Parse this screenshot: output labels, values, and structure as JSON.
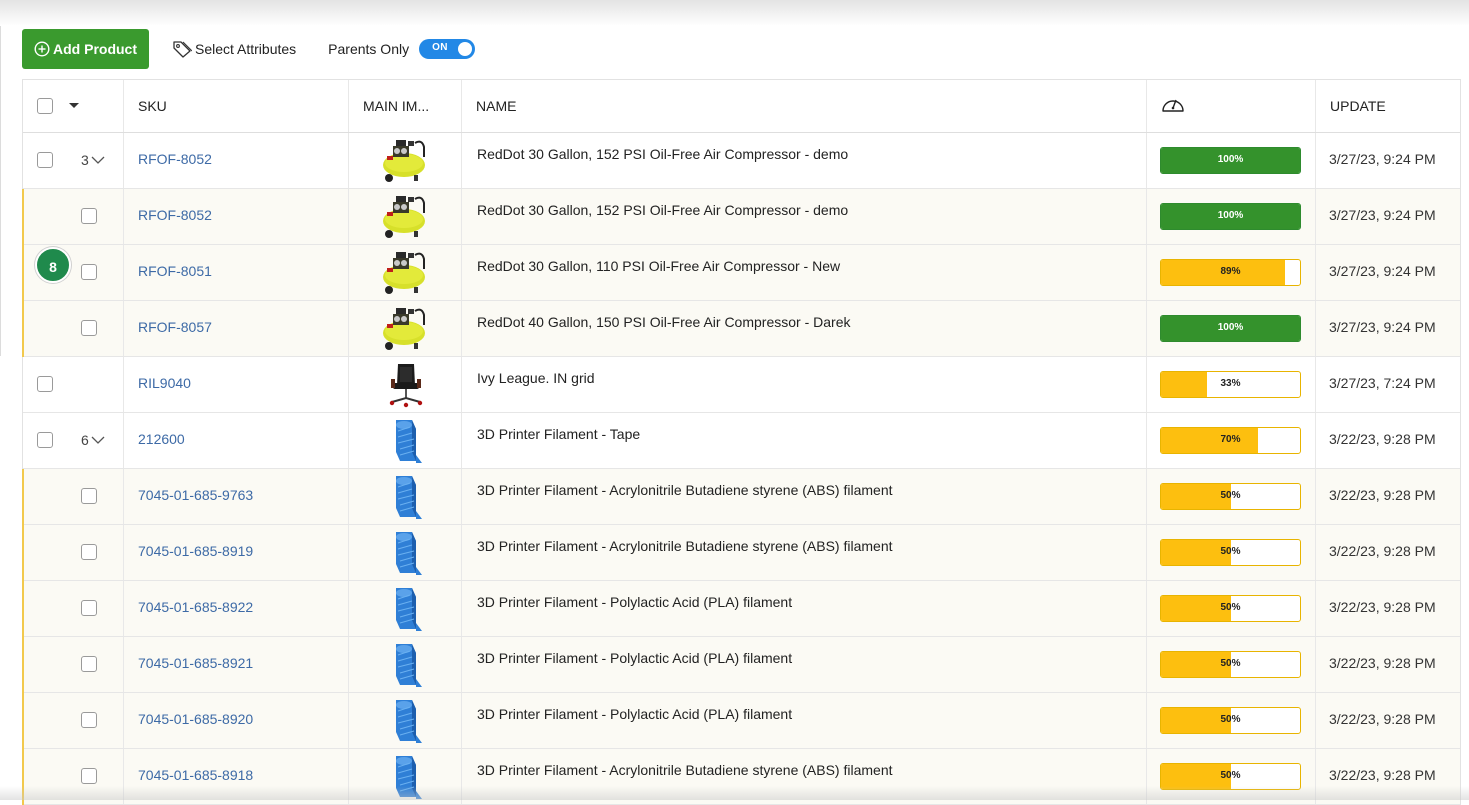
{
  "toolbar": {
    "add_product_label": "Add Product",
    "select_attributes_label": "Select Attributes",
    "parents_only_label": "Parents Only",
    "parents_only_toggle": "ON"
  },
  "table": {
    "headers": {
      "sku": "SKU",
      "main_image": "MAIN IM...",
      "name": "NAME",
      "completeness_icon": "gauge-icon",
      "update": "UPDATE"
    },
    "rows": [
      {
        "type": "parent",
        "expand_count": "3",
        "sku": "RFOF-8052",
        "image": "air-compressor",
        "name": "RedDot 30 Gallon, 152 PSI Oil-Free Air Compressor - demo",
        "completeness": 100,
        "completeness_label": "100%",
        "updated": "3/27/23, 9:24 PM"
      },
      {
        "type": "child",
        "sku": "RFOF-8052",
        "image": "air-compressor",
        "name": "RedDot 30 Gallon, 152 PSI Oil-Free Air Compressor - demo",
        "completeness": 100,
        "completeness_label": "100%",
        "updated": "3/27/23, 9:24 PM"
      },
      {
        "type": "child",
        "sku": "RFOF-8051",
        "image": "air-compressor",
        "name": "RedDot 30 Gallon, 110 PSI Oil-Free Air Compressor - New",
        "completeness": 89,
        "completeness_label": "89%",
        "updated": "3/27/23, 9:24 PM"
      },
      {
        "type": "child",
        "sku": "RFOF-8057",
        "image": "air-compressor",
        "name": "RedDot 40 Gallon, 150 PSI Oil-Free Air Compressor - Darek",
        "completeness": 100,
        "completeness_label": "100%",
        "updated": "3/27/23, 9:24 PM"
      },
      {
        "type": "single",
        "sku": "RIL9040",
        "image": "office-chair",
        "name": "Ivy League. IN grid",
        "completeness": 33,
        "completeness_label": "33%",
        "updated": "3/27/23, 7:24 PM"
      },
      {
        "type": "parent",
        "expand_count": "6",
        "sku": "212600",
        "image": "filament-tape",
        "name": "3D Printer Filament - Tape",
        "completeness": 70,
        "completeness_label": "70%",
        "updated": "3/22/23, 9:28 PM"
      },
      {
        "type": "child",
        "sku": "7045-01-685-9763",
        "image": "filament-tape",
        "name": "3D Printer Filament - Acrylonitrile Butadiene styrene (ABS) filament",
        "completeness": 50,
        "completeness_label": "50%",
        "updated": "3/22/23, 9:28 PM"
      },
      {
        "type": "child",
        "sku": "7045-01-685-8919",
        "image": "filament-tape",
        "name": "3D Printer Filament - Acrylonitrile Butadiene styrene (ABS) filament",
        "completeness": 50,
        "completeness_label": "50%",
        "updated": "3/22/23, 9:28 PM"
      },
      {
        "type": "child",
        "sku": "7045-01-685-8922",
        "image": "filament-tape",
        "name": "3D Printer Filament - Polylactic Acid (PLA) filament",
        "completeness": 50,
        "completeness_label": "50%",
        "updated": "3/22/23, 9:28 PM"
      },
      {
        "type": "child",
        "sku": "7045-01-685-8921",
        "image": "filament-tape",
        "name": "3D Printer Filament - Polylactic Acid (PLA) filament",
        "completeness": 50,
        "completeness_label": "50%",
        "updated": "3/22/23, 9:28 PM"
      },
      {
        "type": "child",
        "sku": "7045-01-685-8920",
        "image": "filament-tape",
        "name": "3D Printer Filament - Polylactic Acid (PLA) filament",
        "completeness": 50,
        "completeness_label": "50%",
        "updated": "3/22/23, 9:28 PM"
      },
      {
        "type": "child",
        "sku": "7045-01-685-8918",
        "image": "filament-tape",
        "name": "3D Printer Filament - Acrylonitrile Butadiene styrene (ABS) filament",
        "completeness": 50,
        "completeness_label": "50%",
        "updated": "3/22/23, 9:28 PM"
      }
    ]
  },
  "badge": {
    "count": "8"
  },
  "colors": {
    "primary_green": "#3a9a2e",
    "complete_green": "#34922c",
    "partial_yellow": "#fdbf0f",
    "link_blue": "#3d6aa6",
    "toggle_blue": "#2288e6",
    "child_accent": "#f2c94c"
  }
}
